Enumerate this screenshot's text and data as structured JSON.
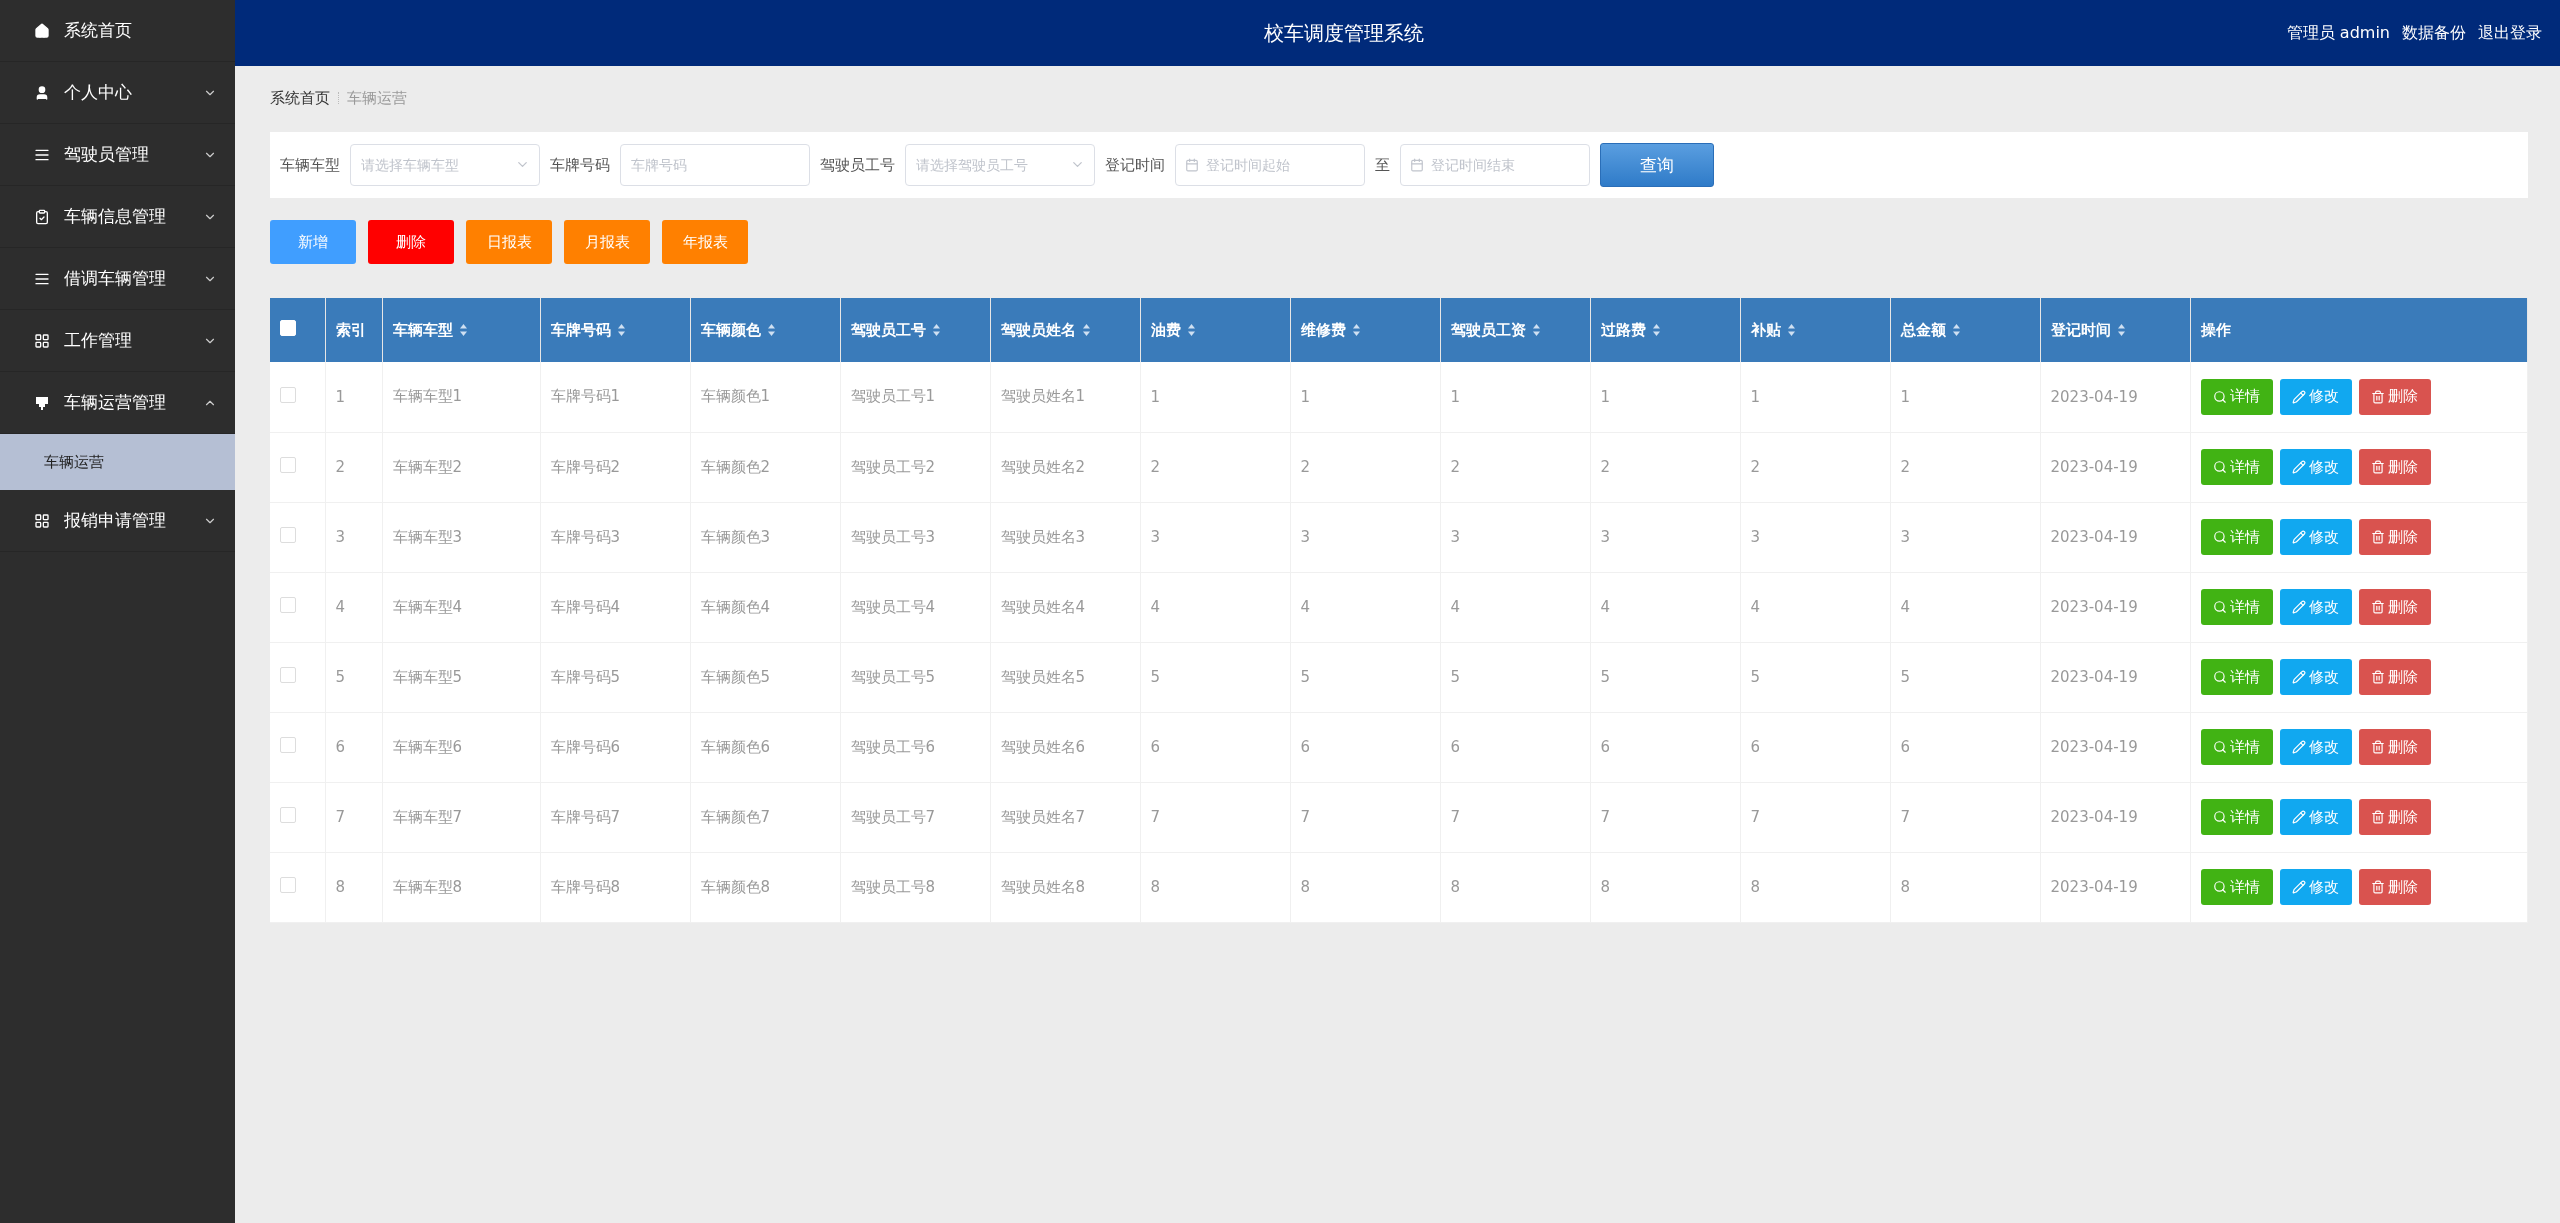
{
  "sidebar": {
    "items": [
      {
        "label": "系统首页"
      },
      {
        "label": "个人中心",
        "expanded": false
      },
      {
        "label": "驾驶员管理",
        "expanded": false
      },
      {
        "label": "车辆信息管理",
        "expanded": false
      },
      {
        "label": "借调车辆管理",
        "expanded": false
      },
      {
        "label": "工作管理",
        "expanded": false
      },
      {
        "label": "车辆运营管理",
        "expanded": true,
        "children": [
          {
            "label": "车辆运营",
            "selected": true
          }
        ]
      },
      {
        "label": "报销申请管理",
        "expanded": false
      }
    ]
  },
  "header": {
    "title": "校车调度管理系统",
    "links": [
      "管理员 admin",
      "数据备份",
      "退出登录"
    ]
  },
  "breadcrumb": [
    "系统首页",
    "车辆运营"
  ],
  "filters": {
    "fields": [
      {
        "kind": "select",
        "label": "车辆车型",
        "placeholder": "请选择车辆车型"
      },
      {
        "kind": "input",
        "label": "车牌号码",
        "placeholder": "车牌号码"
      },
      {
        "kind": "select",
        "label": "驾驶员工号",
        "placeholder": "请选择驾驶员工号"
      },
      {
        "kind": "date",
        "label": "登记时间",
        "placeholder": "登记时间起始"
      },
      {
        "kind": "date",
        "label": "至",
        "placeholder": "登记时间结束"
      }
    ],
    "search_button": "查询"
  },
  "actions": [
    {
      "label": "新增",
      "kind": "add"
    },
    {
      "label": "删除",
      "kind": "delete"
    },
    {
      "label": "日报表",
      "kind": "report"
    },
    {
      "label": "月报表",
      "kind": "report"
    },
    {
      "label": "年报表",
      "kind": "report"
    }
  ],
  "table": {
    "select_all_checked": false,
    "columns": [
      {
        "label": "索引",
        "sortable": false
      },
      {
        "label": "车辆车型",
        "sortable": true
      },
      {
        "label": "车牌号码",
        "sortable": true
      },
      {
        "label": "车辆颜色",
        "sortable": true
      },
      {
        "label": "驾驶员工号",
        "sortable": true
      },
      {
        "label": "驾驶员姓名",
        "sortable": true
      },
      {
        "label": "油费",
        "sortable": true
      },
      {
        "label": "维修费",
        "sortable": true
      },
      {
        "label": "驾驶员工资",
        "sortable": true
      },
      {
        "label": "过路费",
        "sortable": true
      },
      {
        "label": "补贴",
        "sortable": true
      },
      {
        "label": "总金额",
        "sortable": true
      },
      {
        "label": "登记时间",
        "sortable": true
      },
      {
        "label": "操作",
        "sortable": false
      }
    ],
    "row_buttons": [
      [
        {
          "label": "详情",
          "kind": "detail"
        },
        {
          "label": "修改",
          "kind": "edit"
        },
        {
          "label": "删除",
          "kind": "delete"
        }
      ],
      [
        {
          "label": "详情",
          "kind": "detail"
        },
        {
          "label": "修改",
          "kind": "edit"
        },
        {
          "label": "删除",
          "kind": "delete"
        }
      ],
      [
        {
          "label": "详情",
          "kind": "detail"
        },
        {
          "label": "修改",
          "kind": "edit"
        },
        {
          "label": "删除",
          "kind": "delete"
        }
      ],
      [
        {
          "label": "详情",
          "kind": "detail"
        },
        {
          "label": "修改",
          "kind": "edit"
        },
        {
          "label": "删除",
          "kind": "delete"
        }
      ],
      [
        {
          "label": "详情",
          "kind": "detail"
        },
        {
          "label": "修改",
          "kind": "edit"
        },
        {
          "label": "删除",
          "kind": "delete"
        }
      ],
      [
        {
          "label": "详情",
          "kind": "detail"
        },
        {
          "label": "修改",
          "kind": "edit"
        },
        {
          "label": "删除",
          "kind": "delete"
        }
      ],
      [
        {
          "label": "详情",
          "kind": "detail"
        },
        {
          "label": "修改",
          "kind": "edit"
        },
        {
          "label": "删除",
          "kind": "delete"
        }
      ],
      [
        {
          "label": "详情",
          "kind": "detail"
        },
        {
          "label": "修改",
          "kind": "edit"
        },
        {
          "label": "删除",
          "kind": "delete"
        }
      ]
    ],
    "rows": [
      {
        "checked": false,
        "cells": [
          "1",
          "车辆车型1",
          "车牌号码1",
          "车辆颜色1",
          "驾驶员工号1",
          "驾驶员姓名1",
          "1",
          "1",
          "1",
          "1",
          "1",
          "1",
          "2023-04-19"
        ]
      },
      {
        "checked": false,
        "cells": [
          "2",
          "车辆车型2",
          "车牌号码2",
          "车辆颜色2",
          "驾驶员工号2",
          "驾驶员姓名2",
          "2",
          "2",
          "2",
          "2",
          "2",
          "2",
          "2023-04-19"
        ]
      },
      {
        "checked": false,
        "cells": [
          "3",
          "车辆车型3",
          "车牌号码3",
          "车辆颜色3",
          "驾驶员工号3",
          "驾驶员姓名3",
          "3",
          "3",
          "3",
          "3",
          "3",
          "3",
          "2023-04-19"
        ]
      },
      {
        "checked": false,
        "cells": [
          "4",
          "车辆车型4",
          "车牌号码4",
          "车辆颜色4",
          "驾驶员工号4",
          "驾驶员姓名4",
          "4",
          "4",
          "4",
          "4",
          "4",
          "4",
          "2023-04-19"
        ]
      },
      {
        "checked": false,
        "cells": [
          "5",
          "车辆车型5",
          "车牌号码5",
          "车辆颜色5",
          "驾驶员工号5",
          "驾驶员姓名5",
          "5",
          "5",
          "5",
          "5",
          "5",
          "5",
          "2023-04-19"
        ]
      },
      {
        "checked": false,
        "cells": [
          "6",
          "车辆车型6",
          "车牌号码6",
          "车辆颜色6",
          "驾驶员工号6",
          "驾驶员姓名6",
          "6",
          "6",
          "6",
          "6",
          "6",
          "6",
          "2023-04-19"
        ]
      },
      {
        "checked": false,
        "cells": [
          "7",
          "车辆车型7",
          "车牌号码7",
          "车辆颜色7",
          "驾驶员工号7",
          "驾驶员姓名7",
          "7",
          "7",
          "7",
          "7",
          "7",
          "7",
          "2023-04-19"
        ]
      },
      {
        "checked": false,
        "cells": [
          "8",
          "车辆车型8",
          "车牌号码8",
          "车辆颜色8",
          "驾驶员工号8",
          "驾驶员姓名8",
          "8",
          "8",
          "8",
          "8",
          "8",
          "8",
          "2023-04-19"
        ]
      }
    ]
  }
}
